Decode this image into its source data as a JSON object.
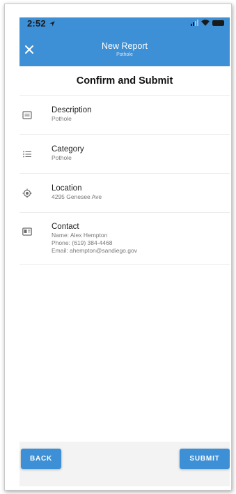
{
  "status_bar": {
    "time": "2:52",
    "location_icon": "location-arrow-icon",
    "signal_icon": "cellular-signal-icon",
    "wifi_icon": "wifi-icon",
    "battery_icon": "battery-icon"
  },
  "header": {
    "title": "New Report",
    "subtitle": "Pothole",
    "close_icon": "close-icon",
    "bg_color": "#3d8fd6"
  },
  "page": {
    "title": "Confirm and Submit"
  },
  "items": [
    {
      "icon": "description-icon",
      "label": "Description",
      "values": [
        "Pothole"
      ]
    },
    {
      "icon": "category-list-icon",
      "label": "Category",
      "values": [
        "Pothole"
      ]
    },
    {
      "icon": "location-target-icon",
      "label": "Location",
      "values": [
        "4295 Genesee Ave"
      ]
    },
    {
      "icon": "contact-card-icon",
      "label": "Contact",
      "values": [
        "Name: Alex Hempton",
        "Phone: (619) 384-4468",
        "Email: ahempton@sandiego.gov"
      ]
    }
  ],
  "buttons": {
    "back_label": "BACK",
    "submit_label": "SUBMIT"
  }
}
